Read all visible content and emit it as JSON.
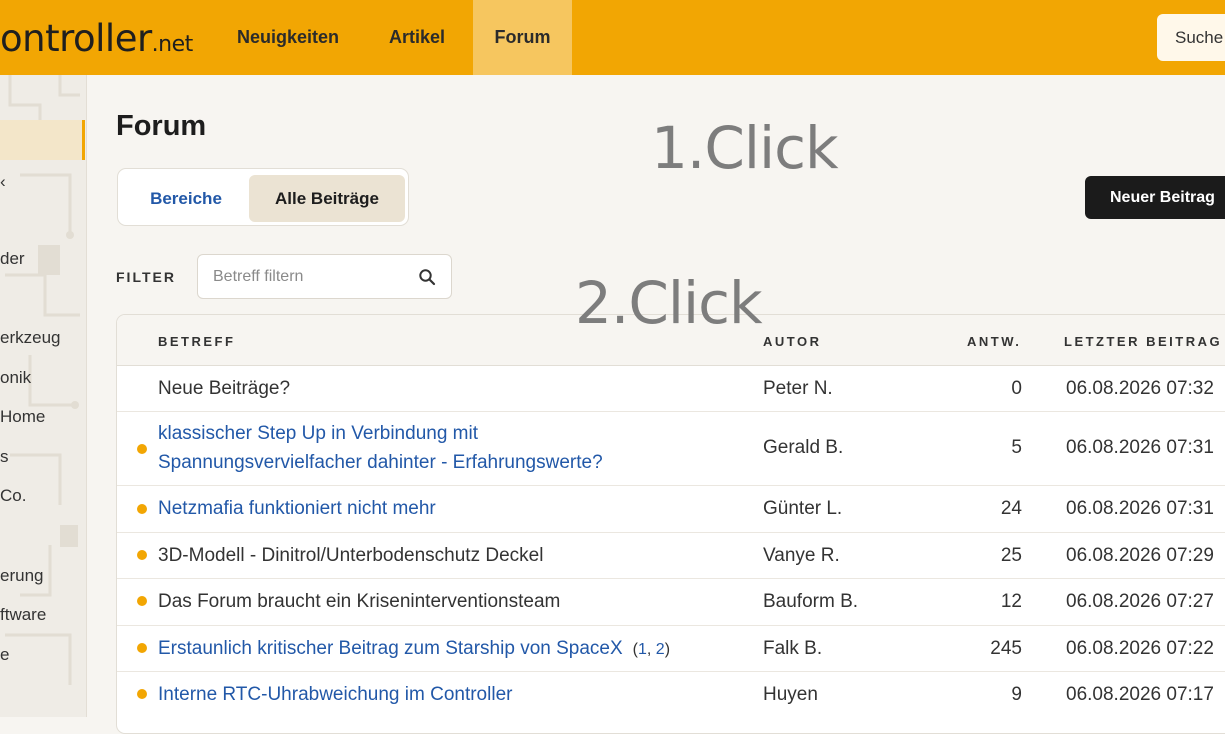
{
  "header": {
    "logo_main": "ontroller",
    "logo_tld": ".net",
    "nav": [
      "Neuigkeiten",
      "Artikel",
      "Forum"
    ],
    "active_nav": "Forum",
    "search_label": "Suche"
  },
  "sidebar": {
    "items": [
      "der",
      "erkzeug",
      "onik",
      "Home",
      "s",
      "Co.",
      "erung",
      "ftware",
      "e"
    ]
  },
  "page": {
    "title": "Forum",
    "tabs": [
      "Bereiche",
      "Alle Beiträge"
    ],
    "active_tab": "Alle Beiträge",
    "new_post_label": "Neuer Beitrag",
    "filter_label": "FILTER",
    "filter_placeholder": "Betreff filtern"
  },
  "overlay": {
    "click1": "1.Click",
    "click2": "2.Click"
  },
  "table": {
    "columns": [
      "BETREFF",
      "AUTOR",
      "ANTW.",
      "LETZTER BEITRAG"
    ],
    "rows": [
      {
        "subject_line1": "Neue Beiträge?",
        "subject_line2": "",
        "author": "Peter N.",
        "replies": "0",
        "last": "06.08.2026 07:32",
        "dot": false,
        "link": false
      },
      {
        "subject_line1": "klassischer Step Up in Verbindung mit",
        "subject_line2": "Spannungsvervielfacher dahinter - Erfahrungswerte?",
        "author": "Gerald B.",
        "replies": "5",
        "last": "06.08.2026 07:31",
        "dot": true,
        "link": true
      },
      {
        "subject_line1": "Netzmafia funktioniert nicht mehr",
        "subject_line2": "",
        "author": "Günter L.",
        "replies": "24",
        "last": "06.08.2026 07:31",
        "dot": true,
        "link": true
      },
      {
        "subject_line1": "3D-Modell - Dinitrol/Unterbodenschutz Deckel",
        "subject_line2": "",
        "author": "Vanye R.",
        "replies": "25",
        "last": "06.08.2026 07:29",
        "dot": true,
        "link": false
      },
      {
        "subject_line1": "Das Forum braucht ein Kriseninterventionsteam",
        "subject_line2": "",
        "author": "Bauform B.",
        "replies": "12",
        "last": "06.08.2026 07:27",
        "dot": true,
        "link": false
      },
      {
        "subject_line1": "Erstaunlich kritischer Beitrag zum Starship von SpaceX",
        "subject_line2": "",
        "author": "Falk B.",
        "replies": "245",
        "last": "06.08.2026 07:22",
        "dot": true,
        "link": true,
        "pages": [
          "1",
          "2"
        ]
      },
      {
        "subject_line1": "Interne RTC-Uhrabweichung im Controller",
        "subject_line2": "",
        "author": "Huyen",
        "replies": "9",
        "last": "06.08.2026 07:17",
        "dot": true,
        "link": true
      }
    ]
  },
  "colors": {
    "accent": "#f2a603",
    "link": "#2258a8"
  }
}
